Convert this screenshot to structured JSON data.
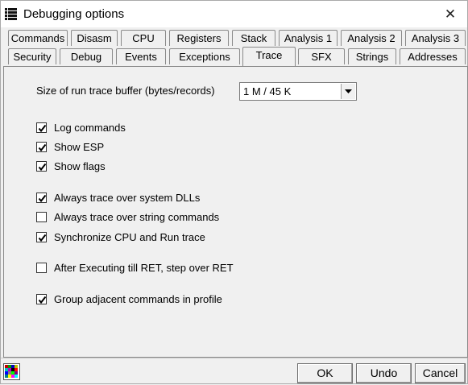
{
  "window": {
    "title": "Debugging options",
    "close_glyph": "✕"
  },
  "tabs_row1": [
    {
      "label": "Commands"
    },
    {
      "label": "Disasm"
    },
    {
      "label": "CPU"
    },
    {
      "label": "Registers"
    },
    {
      "label": "Stack"
    },
    {
      "label": "Analysis 1"
    },
    {
      "label": "Analysis 2"
    },
    {
      "label": "Analysis 3"
    }
  ],
  "tabs_row2": [
    {
      "label": "Security"
    },
    {
      "label": "Debug"
    },
    {
      "label": "Events"
    },
    {
      "label": "Exceptions"
    },
    {
      "label": "Trace",
      "active": true
    },
    {
      "label": "SFX"
    },
    {
      "label": "Strings"
    },
    {
      "label": "Addresses"
    }
  ],
  "trace": {
    "buffer_label": "Size of run trace buffer (bytes/records)",
    "buffer_value": "1 M / 45 K",
    "options": [
      {
        "label": "Log commands",
        "checked": true
      },
      {
        "label": "Show ESP",
        "checked": true
      },
      {
        "label": "Show flags",
        "checked": true
      },
      {
        "label": "Always trace over system DLLs",
        "checked": true
      },
      {
        "label": "Always trace over string commands",
        "checked": false
      },
      {
        "label": "Synchronize CPU and Run trace",
        "checked": true
      },
      {
        "label": "After Executing till RET, step over RET",
        "checked": false
      },
      {
        "label": "Group adjacent commands in profile",
        "checked": true
      }
    ]
  },
  "buttons": {
    "ok": "OK",
    "undo": "Undo",
    "cancel": "Cancel"
  }
}
